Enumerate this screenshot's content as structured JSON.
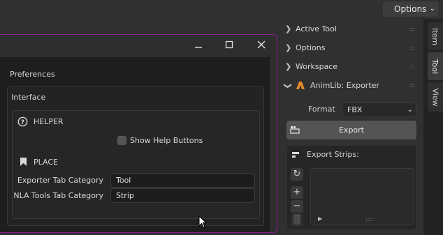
{
  "header": {
    "options_label": "Options"
  },
  "prefs_window": {
    "section_title": "Preferences",
    "panel_title": "Interface",
    "helper_section": {
      "label": "HELPER",
      "checkbox_label": "Show Help Buttons",
      "checked": false
    },
    "place_section": {
      "label": "PLACE",
      "fields": [
        {
          "label": "Exporter Tab Category",
          "value": "Tool"
        },
        {
          "label": "NLA Tools Tab Category",
          "value": "Strip"
        }
      ]
    }
  },
  "sidebar": {
    "panels": [
      {
        "label": "Active Tool"
      },
      {
        "label": "Options"
      },
      {
        "label": "Workspace"
      },
      {
        "label": "AnimLib: Exporter"
      }
    ],
    "format_label": "Format",
    "format_value": "FBX",
    "export_label": "Export",
    "export_strips_label": "Export Strips:"
  },
  "tabs": [
    {
      "label": "Item"
    },
    {
      "label": "Tool"
    },
    {
      "label": "View"
    }
  ],
  "colors": {
    "window_border": "#8e1d8e",
    "accent_orange": "#e38a2e"
  }
}
